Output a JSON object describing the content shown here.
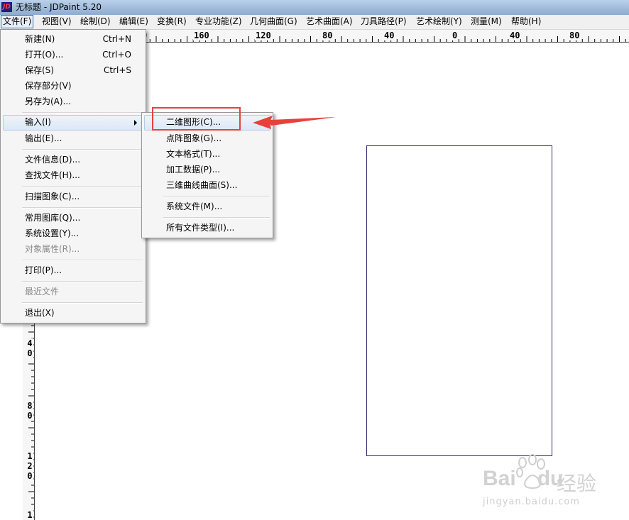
{
  "window": {
    "title": "无标题 - JDPaint 5.20",
    "app_icon_text": "JD"
  },
  "menubar": {
    "items": [
      {
        "label": "文件(F)",
        "active": true
      },
      {
        "label": "视图(V)"
      },
      {
        "label": "绘制(D)"
      },
      {
        "label": "编辑(E)"
      },
      {
        "label": "变换(R)"
      },
      {
        "label": "专业功能(Z)"
      },
      {
        "label": "几何曲面(G)"
      },
      {
        "label": "艺术曲面(A)"
      },
      {
        "label": "刀具路径(P)"
      },
      {
        "label": "艺术绘制(Y)"
      },
      {
        "label": "测量(M)"
      },
      {
        "label": "帮助(H)"
      }
    ]
  },
  "ruler": {
    "horizontal_labels": [
      "0",
      "160",
      "120",
      "80",
      "40",
      "0",
      "40",
      "80"
    ],
    "vertical_labels": [
      "40",
      "80",
      "120",
      "1"
    ]
  },
  "file_menu": {
    "items": [
      {
        "label": "新建(N)",
        "shortcut": "Ctrl+N"
      },
      {
        "label": "打开(O)...",
        "shortcut": "Ctrl+O"
      },
      {
        "label": "保存(S)",
        "shortcut": "Ctrl+S"
      },
      {
        "label": "保存部分(V)"
      },
      {
        "label": "另存为(A)..."
      },
      {
        "label": "输入(I)",
        "submenu": true,
        "highlighted": true
      },
      {
        "label": "输出(E)..."
      },
      {
        "label": "文件信息(D)..."
      },
      {
        "label": "查找文件(H)..."
      },
      {
        "label": "扫描图象(C)..."
      },
      {
        "label": "常用图库(Q)..."
      },
      {
        "label": "系统设置(Y)..."
      },
      {
        "label": "对象属性(R)...",
        "disabled": true
      },
      {
        "label": "打印(P)..."
      },
      {
        "label": "最近文件",
        "disabled": true
      },
      {
        "label": "退出(X)"
      }
    ]
  },
  "import_submenu": {
    "items": [
      {
        "label": "二维图形(C)...",
        "highlighted": true
      },
      {
        "label": "点阵图象(G)..."
      },
      {
        "label": "文本格式(T)..."
      },
      {
        "label": "加工数据(P)..."
      },
      {
        "label": "三维曲线曲面(S)..."
      },
      {
        "label": "系统文件(M)..."
      },
      {
        "label": "所有文件类型(I)..."
      }
    ]
  },
  "watermark": {
    "brand": "Bai",
    "brand2": "du",
    "cn": "经验",
    "url": "jingyan.baidu.com"
  },
  "colors": {
    "annotation_red": "#e8413c",
    "paper_border": "#2a2a6e"
  }
}
